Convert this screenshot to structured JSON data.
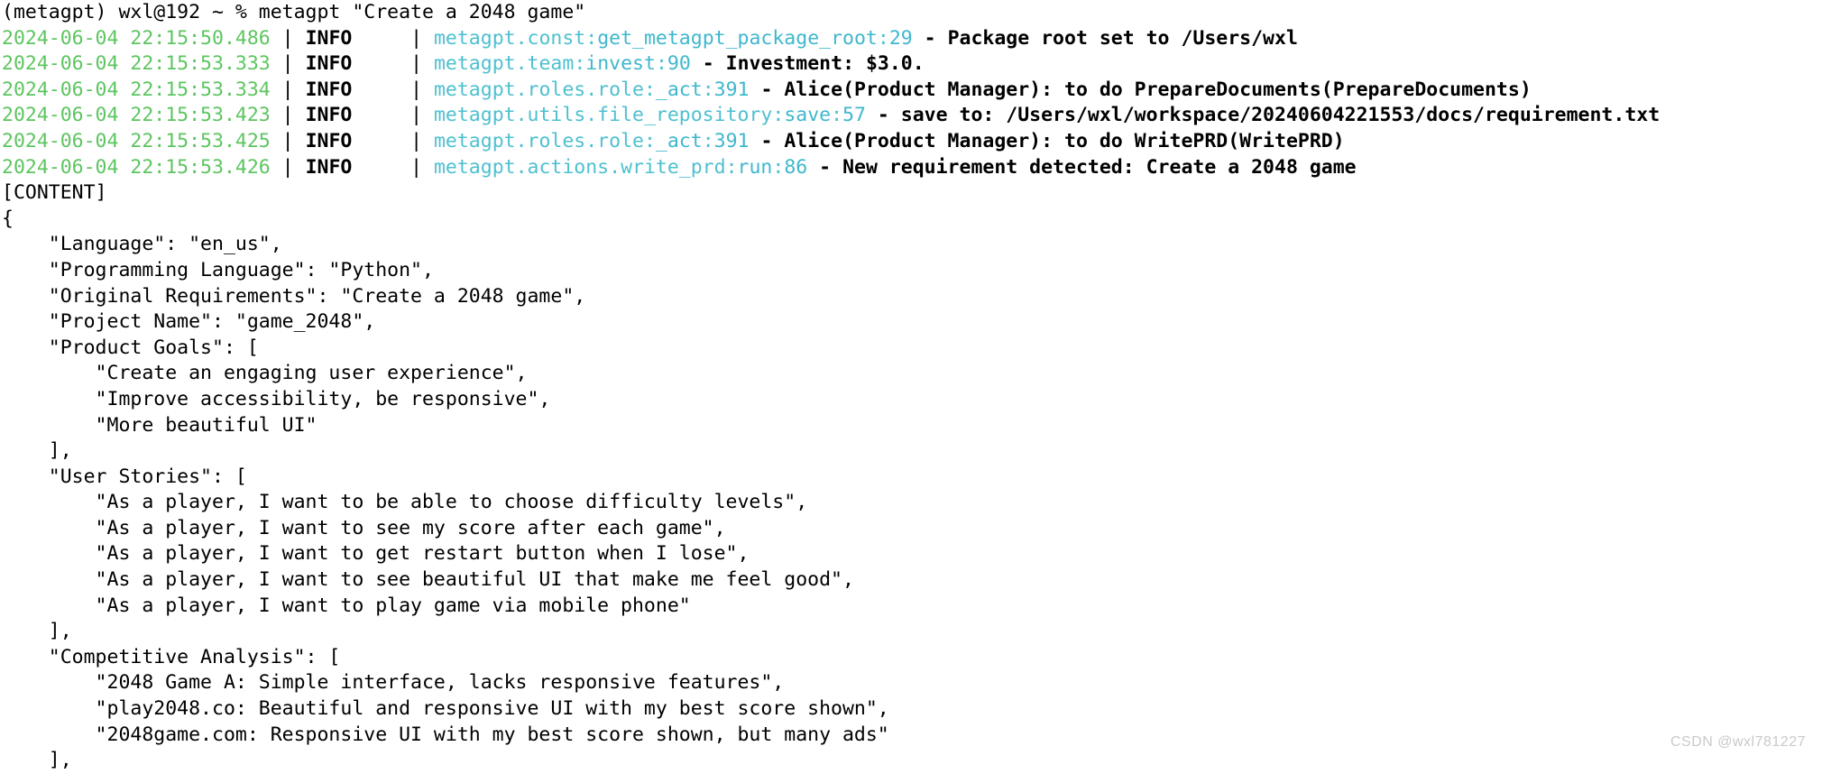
{
  "terminal": {
    "prompt_line": "(metagpt) wxl@192 ~ % metagpt \"Create a 2048 game\"",
    "log_lines": [
      {
        "timestamp": "2024-06-04 22:15:50.486",
        "pipe1": " | ",
        "level": "INFO",
        "level_pad": "    ",
        "pipe2": " | ",
        "module": "metagpt.const",
        "colon1": ":",
        "func": "get_metagpt_package_root",
        "colon2": ":",
        "lineno": "29",
        "dash": " - ",
        "message": "Package root set to /Users/wxl"
      },
      {
        "timestamp": "2024-06-04 22:15:53.333",
        "pipe1": " | ",
        "level": "INFO",
        "level_pad": "    ",
        "pipe2": " | ",
        "module": "metagpt.team",
        "colon1": ":",
        "func": "invest",
        "colon2": ":",
        "lineno": "90",
        "dash": " - ",
        "message": "Investment: $3.0."
      },
      {
        "timestamp": "2024-06-04 22:15:53.334",
        "pipe1": " | ",
        "level": "INFO",
        "level_pad": "    ",
        "pipe2": " | ",
        "module": "metagpt.roles.role",
        "colon1": ":",
        "func": "_act",
        "colon2": ":",
        "lineno": "391",
        "dash": " - ",
        "message": "Alice(Product Manager): to do PrepareDocuments(PrepareDocuments)"
      },
      {
        "timestamp": "2024-06-04 22:15:53.423",
        "pipe1": " | ",
        "level": "INFO",
        "level_pad": "    ",
        "pipe2": " | ",
        "module": "metagpt.utils.file_repository",
        "colon1": ":",
        "func": "save",
        "colon2": ":",
        "lineno": "57",
        "dash": " - ",
        "message": "save to: /Users/wxl/workspace/20240604221553/docs/requirement.txt"
      },
      {
        "timestamp": "2024-06-04 22:15:53.425",
        "pipe1": " | ",
        "level": "INFO",
        "level_pad": "    ",
        "pipe2": " | ",
        "module": "metagpt.roles.role",
        "colon1": ":",
        "func": "_act",
        "colon2": ":",
        "lineno": "391",
        "dash": " - ",
        "message": "Alice(Product Manager): to do WritePRD(WritePRD)"
      },
      {
        "timestamp": "2024-06-04 22:15:53.426",
        "pipe1": " | ",
        "level": "INFO",
        "level_pad": "    ",
        "pipe2": " | ",
        "module": "metagpt.actions.write_prd",
        "colon1": ":",
        "func": "run",
        "colon2": ":",
        "lineno": "86",
        "dash": " - ",
        "message": "New requirement detected: Create a 2048 game"
      }
    ],
    "content_marker": "[CONTENT]",
    "json_lines": [
      "{",
      "    \"Language\": \"en_us\",",
      "    \"Programming Language\": \"Python\",",
      "    \"Original Requirements\": \"Create a 2048 game\",",
      "    \"Project Name\": \"game_2048\",",
      "    \"Product Goals\": [",
      "        \"Create an engaging user experience\",",
      "        \"Improve accessibility, be responsive\",",
      "        \"More beautiful UI\"",
      "    ],",
      "    \"User Stories\": [",
      "        \"As a player, I want to be able to choose difficulty levels\",",
      "        \"As a player, I want to see my score after each game\",",
      "        \"As a player, I want to get restart button when I lose\",",
      "        \"As a player, I want to see beautiful UI that make me feel good\",",
      "        \"As a player, I want to play game via mobile phone\"",
      "    ],",
      "    \"Competitive Analysis\": [",
      "        \"2048 Game A: Simple interface, lacks responsive features\",",
      "        \"play2048.co: Beautiful and responsive UI with my best score shown\",",
      "        \"2048game.com: Responsive UI with my best score shown, but many ads\"",
      "    ],"
    ]
  },
  "watermark": {
    "text": "CSDN @wxl781227"
  },
  "colors": {
    "background": "#ffffff",
    "foreground": "#000000",
    "timestamp_green": "#5dc560",
    "module_cyan": "#4ec0d0",
    "watermark_gray": "#c9c9c9"
  }
}
